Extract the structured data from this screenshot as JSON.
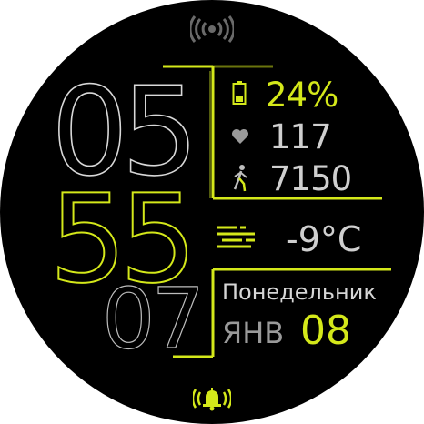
{
  "time": {
    "hour": "05",
    "minute": "55",
    "second": "07"
  },
  "stats": {
    "battery": {
      "icon": "battery-icon",
      "value": "24%"
    },
    "heart_rate": {
      "icon": "heart-icon",
      "value": "117"
    },
    "steps": {
      "icon": "walking-person-icon",
      "value": "7150"
    }
  },
  "weather": {
    "icon": "fog-icon",
    "temperature": "-9°C"
  },
  "date": {
    "weekday": "Понедельник",
    "month": "ЯНВ",
    "day": "08"
  },
  "indicators": {
    "top": "vibration-icon",
    "bottom": "alarm-bell-icon"
  },
  "colors": {
    "accent": "#d4e81a",
    "text": "#cfcfcf",
    "background": "#000000"
  }
}
